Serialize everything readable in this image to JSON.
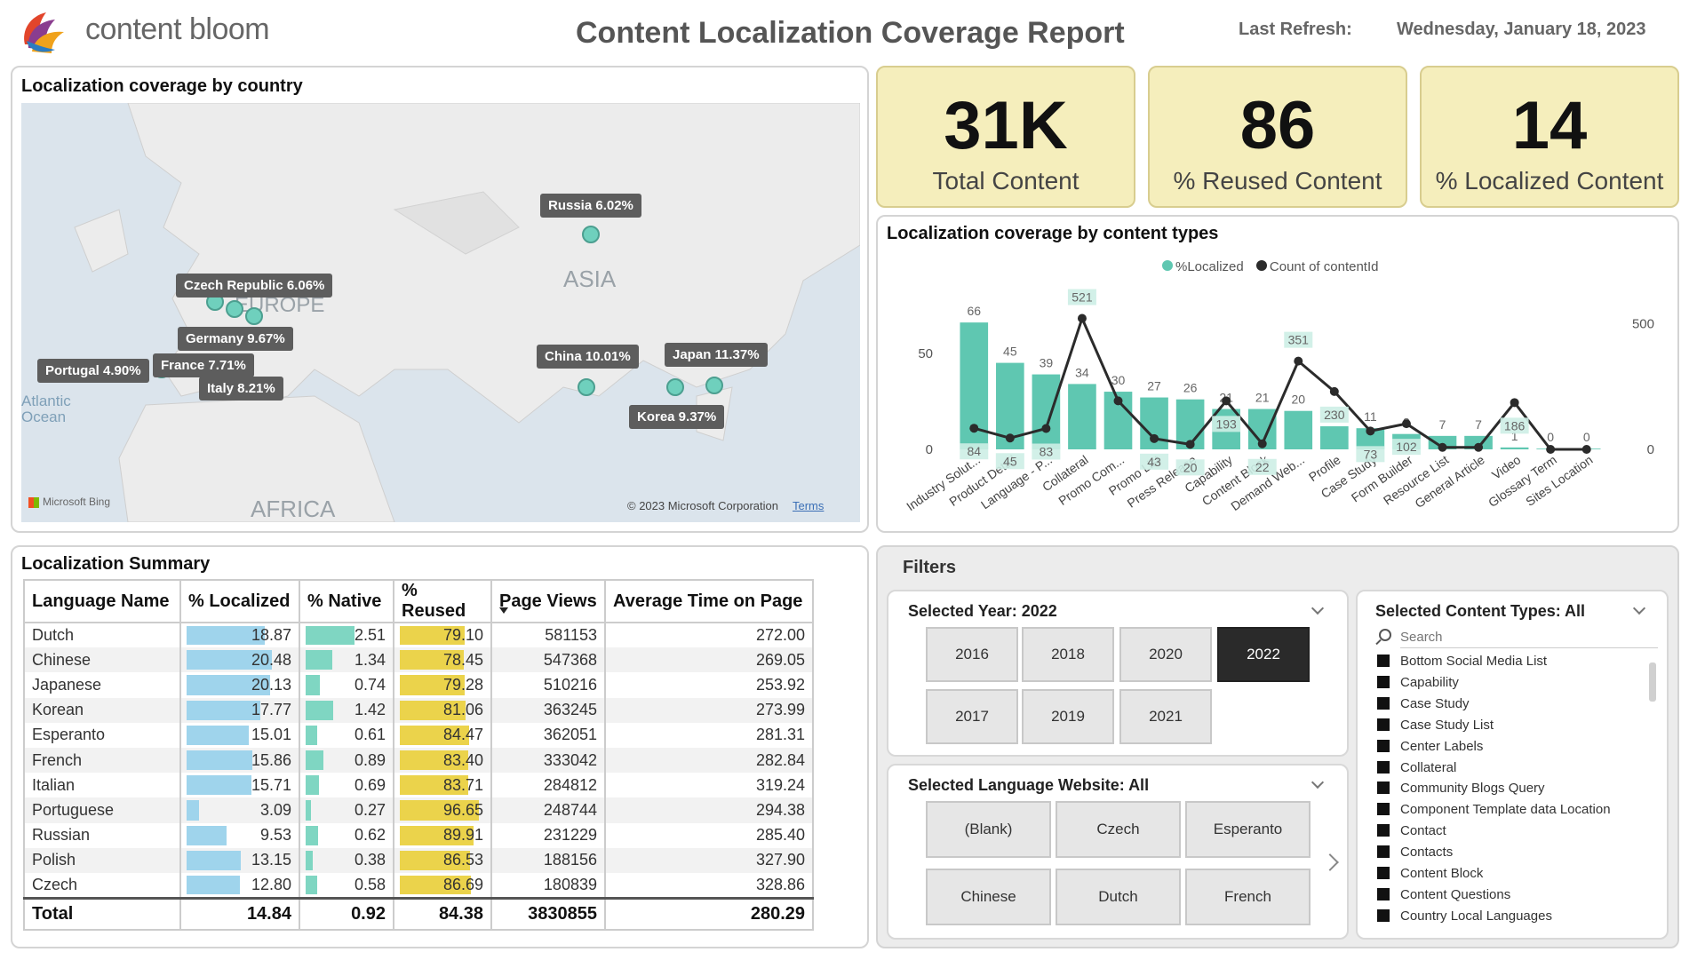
{
  "header": {
    "brand": "content bloom",
    "title": "Content Localization Coverage Report",
    "refresh_label": "Last Refresh:",
    "refresh_value": "Wednesday, January 18, 2023"
  },
  "map": {
    "title": "Localization coverage by country",
    "region_labels": [
      "ASIA",
      "EUROPE",
      "AFRICA",
      "Atlantic",
      "Ocean"
    ],
    "tags": {
      "russia": "Russia 6.02%",
      "czech": "Czech Republic 6.06%",
      "germany": "Germany 9.67%",
      "france": "France 7.71%",
      "portugal": "Portugal 4.90%",
      "italy": "Italy 8.21%",
      "china": "China 10.01%",
      "japan": "Japan 11.37%",
      "korea": "Korea 9.37%"
    },
    "attribution_left": "Microsoft Bing",
    "attribution_right": "© 2023 Microsoft Corporation",
    "terms_link": "Terms"
  },
  "kpis": [
    {
      "value": "31K",
      "label": "Total Content"
    },
    {
      "value": "86",
      "label": "% Reused Content"
    },
    {
      "value": "14",
      "label": "% Localized Content"
    }
  ],
  "chart_data": {
    "type": "bar",
    "title": "Localization coverage by content types",
    "legend": [
      "%Localized",
      "Count of contentId"
    ],
    "legend_position": "top-center",
    "categories": [
      "Industry Solut...",
      "Product Detail",
      "Language - P...",
      "Collateral",
      "Promo Com...",
      "Promo List",
      "Press Release",
      "Capability",
      "Content Block",
      "Demand Web...",
      "Profile",
      "Case Study",
      "Form Builder",
      "Resource List",
      "General Article",
      "Video",
      "Glossary Term",
      "Sites Location"
    ],
    "series": [
      {
        "name": "%Localized",
        "type": "bar",
        "values": [
          66,
          45,
          39,
          34,
          30,
          27,
          26,
          21,
          21,
          20,
          12,
          11,
          8,
          7,
          7,
          1,
          0,
          0
        ]
      },
      {
        "name": "Count of contentId",
        "type": "line",
        "values": [
          84,
          45,
          83,
          521,
          193,
          43,
          20,
          193,
          22,
          351,
          230,
          73,
          102,
          8,
          8,
          186,
          0,
          0
        ]
      }
    ],
    "line_labels": [
      "84",
      "45",
      "83",
      "521",
      "",
      "43",
      "20",
      "193",
      "22",
      "351",
      "230",
      "73",
      "102",
      "",
      "",
      "186",
      "",
      ""
    ],
    "y_left_ticks": [
      "0",
      "50"
    ],
    "y_right_ticks": [
      "0",
      "500"
    ],
    "y_left_range": [
      0,
      85
    ],
    "y_right_range": [
      0,
      650
    ]
  },
  "summary": {
    "title": "Localization Summary",
    "columns": [
      "Language Name",
      "% Localized",
      "% Native",
      "% Reused",
      "Page Views",
      "Average Time on Page"
    ],
    "rows": [
      {
        "lang": "Dutch",
        "loc": "18.87",
        "nat": "2.51",
        "reu": "79.10",
        "pv": "581153",
        "atp": "272.00",
        "loc_v": 18.87,
        "nat_v": 2.51,
        "reu_v": 79.1
      },
      {
        "lang": "Chinese",
        "loc": "20.48",
        "nat": "1.34",
        "reu": "78.45",
        "pv": "547368",
        "atp": "269.05",
        "loc_v": 20.48,
        "nat_v": 1.34,
        "reu_v": 78.45
      },
      {
        "lang": "Japanese",
        "loc": "20.13",
        "nat": "0.74",
        "reu": "79.28",
        "pv": "510216",
        "atp": "253.92",
        "loc_v": 20.13,
        "nat_v": 0.74,
        "reu_v": 79.28
      },
      {
        "lang": "Korean",
        "loc": "17.77",
        "nat": "1.42",
        "reu": "81.06",
        "pv": "363245",
        "atp": "273.99",
        "loc_v": 17.77,
        "nat_v": 1.42,
        "reu_v": 81.06
      },
      {
        "lang": "Esperanto",
        "loc": "15.01",
        "nat": "0.61",
        "reu": "84.47",
        "pv": "362051",
        "atp": "281.31",
        "loc_v": 15.01,
        "nat_v": 0.61,
        "reu_v": 84.47
      },
      {
        "lang": "French",
        "loc": "15.86",
        "nat": "0.89",
        "reu": "83.40",
        "pv": "333042",
        "atp": "282.84",
        "loc_v": 15.86,
        "nat_v": 0.89,
        "reu_v": 83.4
      },
      {
        "lang": "Italian",
        "loc": "15.71",
        "nat": "0.69",
        "reu": "83.71",
        "pv": "284812",
        "atp": "319.24",
        "loc_v": 15.71,
        "nat_v": 0.69,
        "reu_v": 83.71
      },
      {
        "lang": "Portuguese",
        "loc": "3.09",
        "nat": "0.27",
        "reu": "96.65",
        "pv": "248744",
        "atp": "294.38",
        "loc_v": 3.09,
        "nat_v": 0.27,
        "reu_v": 96.65
      },
      {
        "lang": "Russian",
        "loc": "9.53",
        "nat": "0.62",
        "reu": "89.91",
        "pv": "231229",
        "atp": "285.40",
        "loc_v": 9.53,
        "nat_v": 0.62,
        "reu_v": 89.91
      },
      {
        "lang": "Polish",
        "loc": "13.15",
        "nat": "0.38",
        "reu": "86.53",
        "pv": "188156",
        "atp": "327.90",
        "loc_v": 13.15,
        "nat_v": 0.38,
        "reu_v": 86.53
      },
      {
        "lang": "Czech",
        "loc": "12.80",
        "nat": "0.58",
        "reu": "86.69",
        "pv": "180839",
        "atp": "328.86",
        "loc_v": 12.8,
        "nat_v": 0.58,
        "reu_v": 86.69
      }
    ],
    "total": {
      "label": "Total",
      "loc": "14.84",
      "nat": "0.92",
      "reu": "84.38",
      "pv": "3830855",
      "atp": "280.29"
    }
  },
  "filters": {
    "title": "Filters",
    "year_title": "Selected Year: 2022",
    "years": [
      "2016",
      "2018",
      "2020",
      "2022",
      "2017",
      "2019",
      "2021"
    ],
    "selected_year": "2022",
    "lang_title": "Selected Language Website: All",
    "languages": [
      "(Blank)",
      "Czech",
      "Esperanto",
      "Chinese",
      "Dutch",
      "French"
    ],
    "types_title": "Selected Content Types: All",
    "search_placeholder": "Search",
    "content_types": [
      "Bottom Social Media List",
      "Capability",
      "Case Study",
      "Case Study List",
      "Center Labels",
      "Collateral",
      "Community Blogs Query",
      "Component Template data Location",
      "Contact",
      "Contacts",
      "Content Block",
      "Content Questions",
      "Country Local Languages"
    ]
  },
  "colors": {
    "bar": "#5fc7b1",
    "bar_light": "#c3e9df",
    "line": "#2b2b2b",
    "kpi_bg": "#f5eebc",
    "selected": "#2a2a2a"
  }
}
